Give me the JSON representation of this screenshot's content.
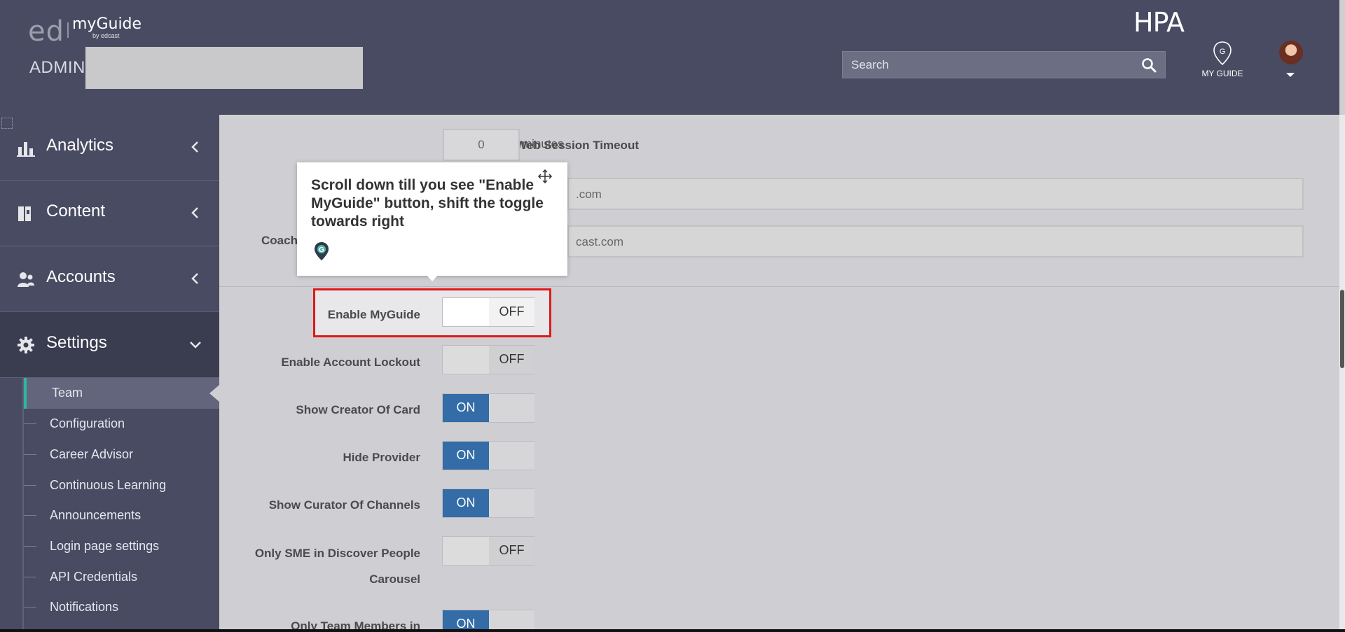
{
  "header": {
    "logo_ed": "ed",
    "logo_myguide": "myGuide",
    "logo_byline": "by edcast",
    "admin_label": "ADMIN",
    "brand": "HPA",
    "search_placeholder": "Search",
    "myguide_label": "MY GUIDE"
  },
  "sidebar": {
    "items": [
      {
        "label": "Analytics",
        "icon": "bar-chart-icon",
        "state": "collapsed"
      },
      {
        "label": "Content",
        "icon": "book-icon",
        "state": "collapsed"
      },
      {
        "label": "Accounts",
        "icon": "users-icon",
        "state": "collapsed"
      },
      {
        "label": "Settings",
        "icon": "gear-icon",
        "state": "expanded"
      }
    ],
    "subitems": [
      {
        "label": "Team",
        "active": true
      },
      {
        "label": "Configuration"
      },
      {
        "label": "Career Advisor"
      },
      {
        "label": "Continuous Learning"
      },
      {
        "label": "Announcements"
      },
      {
        "label": "Login page settings"
      },
      {
        "label": "API Credentials"
      },
      {
        "label": "Notifications"
      }
    ]
  },
  "settings": {
    "inactive_timeout_label": "Inactive Web Session Timeout",
    "inactive_timeout_value": "0",
    "inactive_timeout_unit": "minutes",
    "email_partial_1": ".com",
    "coach_label": "Coach",
    "email_partial_2": "cast.com",
    "toggles": [
      {
        "label": "Enable MyGuide",
        "state": "OFF"
      },
      {
        "label": "Enable Account Lockout",
        "state": "OFF"
      },
      {
        "label": "Show Creator Of Card",
        "state": "ON"
      },
      {
        "label": "Hide Provider",
        "state": "ON"
      },
      {
        "label": "Show Curator Of Channels",
        "state": "ON"
      },
      {
        "label_line1": "Only SME in Discover People",
        "label_line2": "Carousel",
        "state": "OFF"
      },
      {
        "label": "Only Team Members in",
        "state": "ON"
      }
    ]
  },
  "tooltip": {
    "text": "Scroll down till you see \"Enable MyGuide\" button, shift the toggle towards right"
  },
  "colors": {
    "header_bg": "#484b62",
    "content_bg": "#cfcfd3",
    "toggle_on": "#336ca6",
    "highlight": "#e01818",
    "active_accent": "#2db7a3"
  }
}
